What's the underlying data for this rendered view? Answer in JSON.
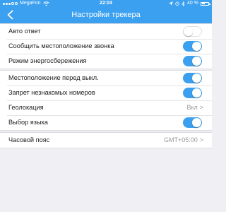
{
  "status_bar": {
    "carrier": "MegaFon",
    "time": "22:04",
    "battery": "40 %"
  },
  "nav": {
    "title": "Настройки трекера",
    "back_icon": "chevron-left-icon"
  },
  "colors": {
    "accent": "#3ba0ef",
    "background": "#efeff4"
  },
  "groups": [
    {
      "rows": [
        {
          "label": "Авто ответ",
          "control": "toggle",
          "on": false
        },
        {
          "label": "Сообщить местоположение звонка",
          "control": "toggle",
          "on": true
        },
        {
          "label": "Режим энергосбережения",
          "control": "toggle",
          "on": true
        }
      ]
    },
    {
      "rows": [
        {
          "label": "Местоположение перед выкл.",
          "control": "toggle",
          "on": true
        },
        {
          "label": "Запрет незнакомых номеров",
          "control": "toggle",
          "on": true
        },
        {
          "label": "Геолокация",
          "control": "value",
          "value": "Вкл",
          "chevron": ">"
        },
        {
          "label": "Выбор языка",
          "control": "toggle",
          "on": true
        }
      ]
    },
    {
      "rows": [
        {
          "label": "Часовой пояс",
          "control": "value",
          "value": "GMT+05:00",
          "chevron": ">"
        }
      ]
    }
  ]
}
